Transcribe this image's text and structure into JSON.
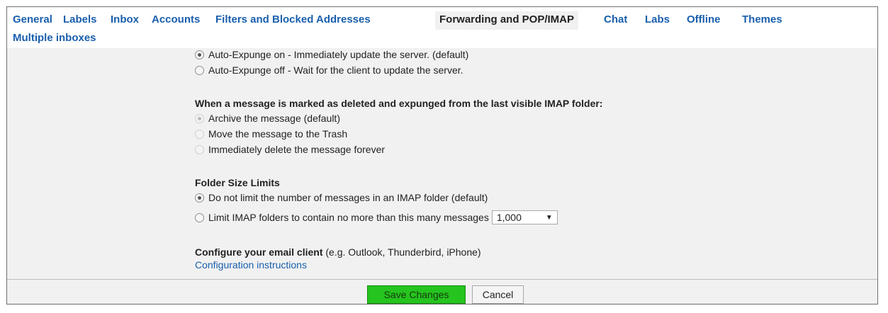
{
  "tabs": [
    {
      "label": "General",
      "active": false
    },
    {
      "label": "Labels",
      "active": false
    },
    {
      "label": "Inbox",
      "active": false
    },
    {
      "label": "Accounts",
      "active": false
    },
    {
      "label": "Filters and Blocked Addresses",
      "active": false
    },
    {
      "label": "Forwarding and POP/IMAP",
      "active": true
    },
    {
      "label": "Chat",
      "active": false
    },
    {
      "label": "Labs",
      "active": false
    },
    {
      "label": "Offline",
      "active": false
    },
    {
      "label": "Themes",
      "active": false
    },
    {
      "label": "Multiple inboxes",
      "active": false
    }
  ],
  "expunge": {
    "options": [
      {
        "label": "Auto-Expunge on - Immediately update the server. (default)",
        "checked": true
      },
      {
        "label": "Auto-Expunge off - Wait for the client to update the server.",
        "checked": false
      }
    ]
  },
  "deleted": {
    "heading": "When a message is marked as deleted and expunged from the last visible IMAP folder:",
    "options": [
      {
        "label": "Archive the message (default)",
        "checked": true,
        "disabled": true
      },
      {
        "label": "Move the message to the Trash",
        "checked": false,
        "disabled": true
      },
      {
        "label": "Immediately delete the message forever",
        "checked": false,
        "disabled": true
      }
    ]
  },
  "folder_size": {
    "heading": "Folder Size Limits",
    "options": [
      {
        "label": "Do not limit the number of messages in an IMAP folder (default)",
        "checked": true
      },
      {
        "label": "Limit IMAP folders to contain no more than this many messages",
        "checked": false
      }
    ],
    "limit_value": "1,000"
  },
  "client": {
    "heading": "Configure your email client",
    "note": " (e.g. Outlook, Thunderbird, iPhone)",
    "link": "Configuration instructions"
  },
  "footer": {
    "save_label": "Save Changes",
    "cancel_label": "Cancel"
  }
}
